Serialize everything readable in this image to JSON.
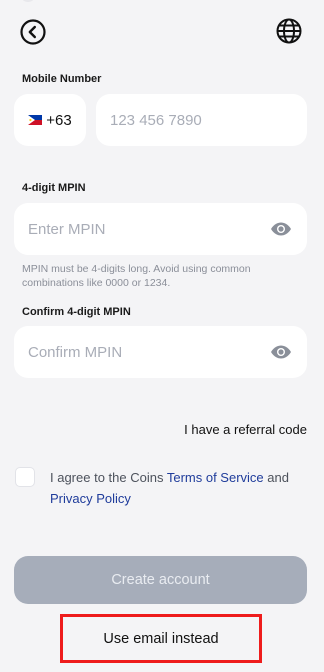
{
  "header": {
    "back_icon": "chevron-left-circle-icon",
    "language_icon": "globe-icon"
  },
  "mobile": {
    "label": "Mobile Number",
    "country_flag": "philippines-flag-icon",
    "country_code": "+63",
    "placeholder": "123 456 7890",
    "value": ""
  },
  "mpin": {
    "label": "4-digit MPIN",
    "placeholder": "Enter MPIN",
    "value": "",
    "hint": "MPIN must be 4-digits long. Avoid using common combinations like 0000 or 1234."
  },
  "confirm_mpin": {
    "label": "Confirm 4-digit MPIN",
    "placeholder": "Confirm MPIN",
    "value": ""
  },
  "referral_label": "I have a referral code",
  "terms": {
    "prefix": "I agree to the Coins ",
    "terms_link": "Terms of Service",
    "middle": " and ",
    "privacy_link": "Privacy Policy",
    "checked": false
  },
  "actions": {
    "create_account": "Create account",
    "use_email": "Use email instead"
  },
  "colors": {
    "background": "#f4f4f6",
    "link": "#1f3c9b",
    "disabled_button": "#a6adba",
    "highlight": "#ee1c1c"
  }
}
